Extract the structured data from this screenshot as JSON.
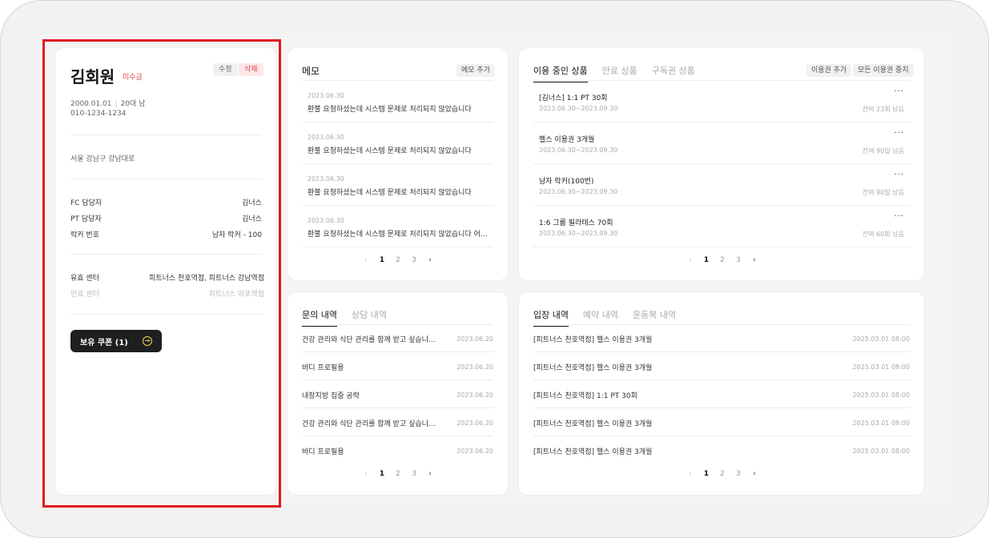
{
  "profile": {
    "name": "김회원",
    "badge": "미수금",
    "edit_label": "수정",
    "delete_label": "삭제",
    "birth": "2000.01.01",
    "age_gender": "20대 남",
    "phone": "010-1234-1234",
    "address": "서울 강남구 강남대로",
    "details": [
      {
        "key": "FC 담당자",
        "value": "김너스"
      },
      {
        "key": "PT 담당자",
        "value": "김너스"
      },
      {
        "key": "락커 번호",
        "value": "남자 락커 - 100"
      }
    ],
    "centers": [
      {
        "key": "유효 센터",
        "value": "피트너스 천호역점, 피트너스 강남역점"
      },
      {
        "key": "만료 센터",
        "value": "피트너스 마포역점"
      }
    ],
    "coupon_label": "보유 쿠폰 (1)"
  },
  "memo": {
    "title": "메모",
    "add_label": "메모 추가",
    "items": [
      {
        "date": "2023.06.30",
        "text": "환불 요청하셨는데 시스템 문제로 처리되지 않았습니다"
      },
      {
        "date": "2023.06.30",
        "text": "환불 요청하셨는데 시스템 문제로 처리되지 않았습니다"
      },
      {
        "date": "2023.06.30",
        "text": "환불 요청하셨는데 시스템 문제로 처리되지 않았습니다"
      },
      {
        "date": "2023.06.30",
        "text": "환불 요청하셨는데 시스템 문제로 처리되지 않았습니다 어짜구..."
      }
    ],
    "pages": [
      "1",
      "2",
      "3"
    ]
  },
  "products": {
    "tabs": [
      "이용 중인 상품",
      "만료 상품",
      "구독권 상품"
    ],
    "add_label": "이용권 추가",
    "stop_label": "모든 이용권 중지",
    "items": [
      {
        "name": "[김너스] 1:1 PT 30회",
        "range": "2023.06.30~2023.09.30",
        "remain": "잔여 23회 남음"
      },
      {
        "name": "헬스 이용권 3개월",
        "range": "2023.06.30~2023.09.30",
        "remain": "잔여 90일 남음"
      },
      {
        "name": "남자 락커(100번)",
        "range": "2023.06.30~2023.09.30",
        "remain": "잔여 90일 남음"
      },
      {
        "name": "1:6 그룹 필라테스 70회",
        "range": "2023.06.30~2023.09.30",
        "remain": "잔여 60회 남음"
      }
    ],
    "pages": [
      "1",
      "2",
      "3"
    ]
  },
  "inquiry": {
    "tabs": [
      "문의 내역",
      "상담 내역"
    ],
    "items": [
      {
        "text": "건강 관리와 식단 관리를 함께 받고 싶습니다람...",
        "date": "2023.06.20"
      },
      {
        "text": "바디 프로필용",
        "date": "2023.06.20"
      },
      {
        "text": "내장지방 집중 공략",
        "date": "2023.06.20"
      },
      {
        "text": "건강 관리와 식단 관리를 함께 받고 싶습니다람...",
        "date": "2023.06.20"
      },
      {
        "text": "바디 프로필용",
        "date": "2023.06.20"
      }
    ],
    "pages": [
      "1",
      "2",
      "3"
    ]
  },
  "entry": {
    "tabs": [
      "입장 내역",
      "예약 내역",
      "운동복 내역"
    ],
    "items": [
      {
        "text": "[피트너스 천호역점] 헬스 이용권 3개월",
        "date": "2025.03.01 08:00"
      },
      {
        "text": "[피트너스 천호역점] 헬스 이용권 3개월",
        "date": "2025.03.01 08:00"
      },
      {
        "text": "[피트너스 천호역점] 1:1 PT 30회",
        "date": "2025.03.01 08:00"
      },
      {
        "text": "[피트너스 천호역점] 헬스 이용권 3개월",
        "date": "2025.03.01 08:00"
      },
      {
        "text": "[피트너스 천호역점] 헬스 이용권 3개월",
        "date": "2025.03.01 08:00"
      }
    ],
    "pages": [
      "1",
      "2",
      "3"
    ]
  },
  "colors": {
    "accent_red": "#e2414a",
    "highlight": "#e0181f",
    "coupon_bg": "#1f1f22",
    "coupon_icon": "#f2d74e"
  }
}
